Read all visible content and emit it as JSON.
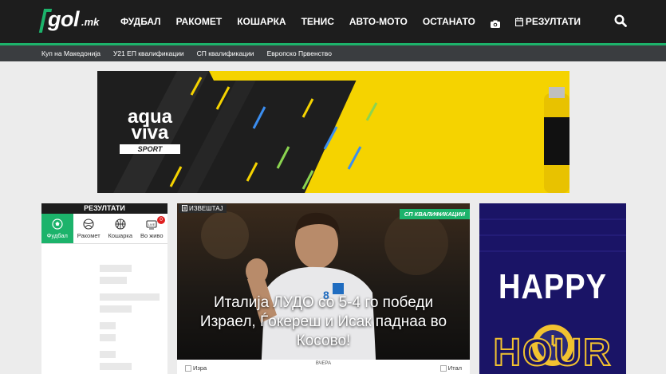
{
  "header": {
    "logo_text": "gol",
    "logo_suffix": ".mk",
    "nav": [
      "ФУДБАЛ",
      "РАКОМЕТ",
      "КОШАРКА",
      "ТЕНИС",
      "АВТО-МОТО",
      "ОСТАНАТО"
    ],
    "camera_icon": "camera-icon",
    "results_label": "РЕЗУЛТАТИ",
    "search_icon": "search-icon"
  },
  "subnav": [
    "Куп на Македонија",
    "У21 ЕП квалификации",
    "СП квалификации",
    "Европско Првенство"
  ],
  "banner": {
    "brand_line1": "aqua",
    "brand_line2": "viva",
    "brand_line3": "SPORT"
  },
  "results_widget": {
    "title": "РЕЗУЛТАТИ",
    "tabs": [
      {
        "label": "Фудбал",
        "icon": "football-icon"
      },
      {
        "label": "Ракомет",
        "icon": "handball-icon"
      },
      {
        "label": "Кошарка",
        "icon": "basketball-icon"
      },
      {
        "label": "Во живо",
        "icon": "live-icon",
        "badge": "0"
      }
    ]
  },
  "article": {
    "type_tag": "ИЗВЕШТАЈ",
    "category": "СП КВАЛИФИКАЦИИ",
    "headline": "Италија ЛУДО со 5-4 го победи Израел, Ѓокереш и Исак паднаа во Косово!",
    "score_home": "Изра",
    "score_when": "ВЧЕРА",
    "score_away": "Итал"
  },
  "ad": {
    "line1": "HAPPY",
    "line2": "HOUR"
  },
  "colors": {
    "accent": "#1cb36b",
    "topbar": "#1d1d1d",
    "subnav": "#3a3d40",
    "ad_bg": "#1a1466"
  }
}
